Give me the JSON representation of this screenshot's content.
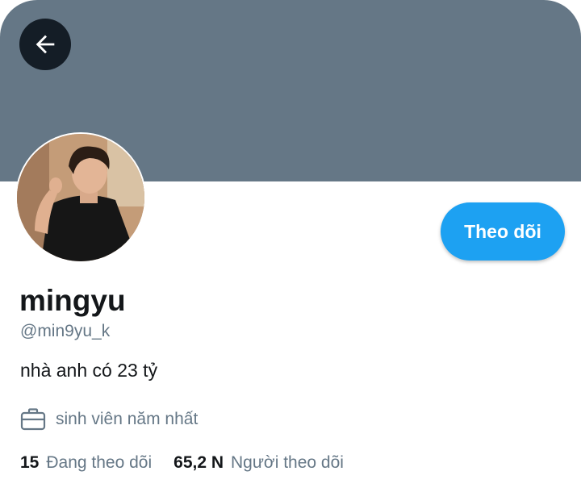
{
  "profile": {
    "name": "mingyu",
    "handle": "@min9yu_k",
    "bio": "nhà anh có 23 tỷ",
    "occupation": "sinh viên năm nhất"
  },
  "actions": {
    "follow_label": "Theo dõi"
  },
  "stats": {
    "following_count": "15",
    "following_label": "Đang theo dõi",
    "followers_count": "65,2 N",
    "followers_label": "Người theo dõi"
  },
  "icons": {
    "back": "arrow-left-icon",
    "occupation": "briefcase-icon"
  },
  "colors": {
    "banner": "#657786",
    "accent": "#1da1f2",
    "back_button": "#141d26",
    "secondary_text": "#657786"
  }
}
